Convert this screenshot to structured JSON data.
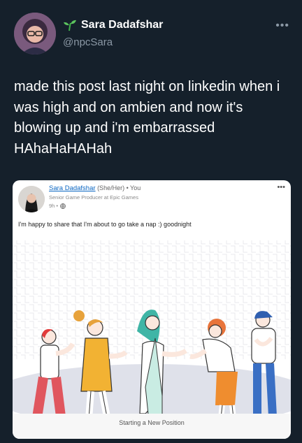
{
  "tweet": {
    "author_name": "Sara Dadafshar",
    "author_handle": "@npcSara",
    "more_label": "•••",
    "text": "made this post last night on linkedin when i was high and on ambien and now it's blowing up and i'm embarrassed HAhaHaHAHah"
  },
  "linkedin_post": {
    "author_name": "Sara Dadafshar",
    "pronouns_meta": "(She/Her) • You",
    "headline": "Senior Game Producer at Epic Games",
    "time": "9h •",
    "more_label": "•••",
    "text": "I'm happy to share that I'm about to go take a nap :) goodnight",
    "caption": "Starting a New Position"
  }
}
